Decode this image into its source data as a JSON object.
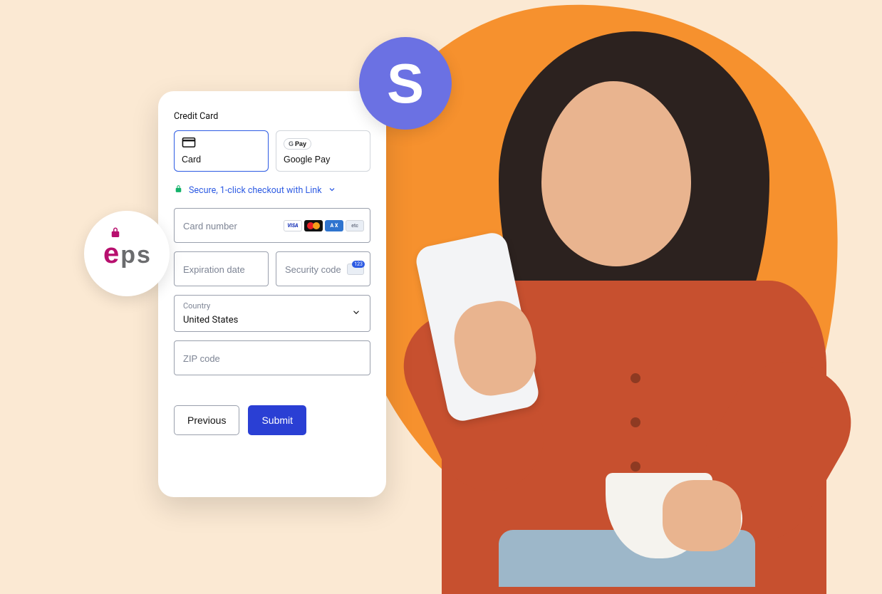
{
  "badges": {
    "stripe_letter": "S",
    "eps_text": "eps"
  },
  "form": {
    "section_title": "Credit Card",
    "methods": {
      "card_label": "Card",
      "gpay_label": "Google Pay",
      "gpay_badge_prefix": "G",
      "gpay_badge_suffix": "Pay"
    },
    "secure_text": "Secure, 1-click checkout with Link",
    "card_number_placeholder": "Card number",
    "expiry_placeholder": "Expiration date",
    "cvc_placeholder": "Security code",
    "country_label": "Country",
    "country_value": "United States",
    "zip_placeholder": "ZIP code",
    "card_brands": {
      "visa": "VISA",
      "amex": "A X",
      "etc": "etc"
    },
    "actions": {
      "previous": "Previous",
      "submit": "Submit"
    }
  }
}
